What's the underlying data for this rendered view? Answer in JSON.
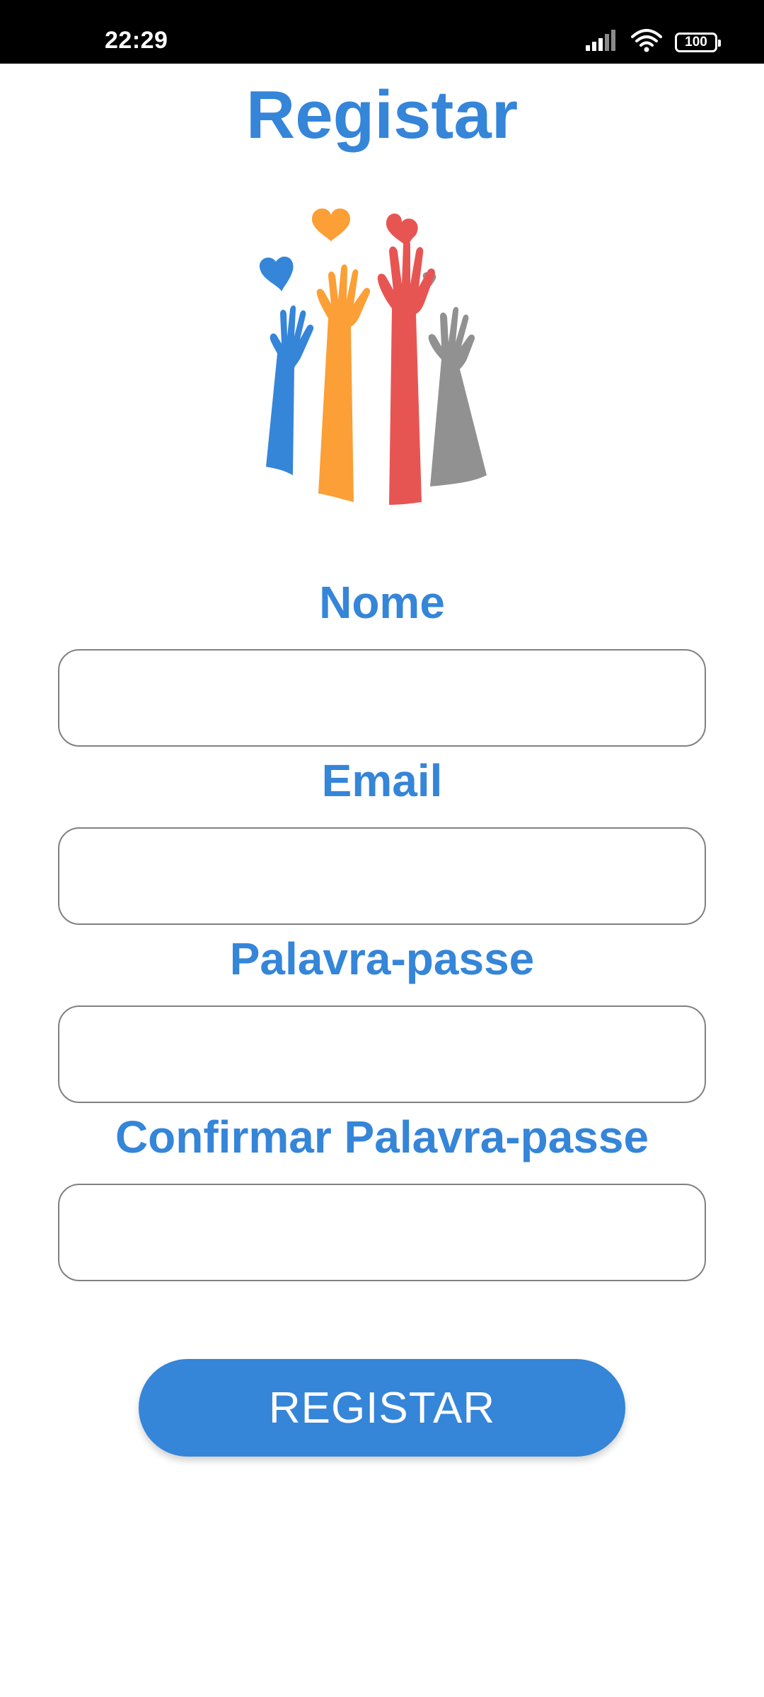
{
  "status_bar": {
    "time": "22:29",
    "battery": "100",
    "icons": [
      "signal-icon",
      "wifi-icon",
      "battery-icon"
    ]
  },
  "page": {
    "title": "Registar"
  },
  "logo": {
    "name": "raised-hands-hearts-illustration",
    "colors": {
      "blue": "#3585d9",
      "orange": "#fb9f36",
      "red": "#e75552",
      "gray": "#919191"
    }
  },
  "form": {
    "name_label": "Nome",
    "email_label": "Email",
    "password_label": "Palavra-passe",
    "confirm_password_label": "Confirmar Palavra-passe",
    "name_value": "",
    "email_value": "",
    "password_value": "",
    "confirm_password_value": "",
    "submit_label": "REGISTAR"
  },
  "colors": {
    "accent": "#3585d9",
    "input_border": "#808080",
    "status_bar": "#000000"
  }
}
